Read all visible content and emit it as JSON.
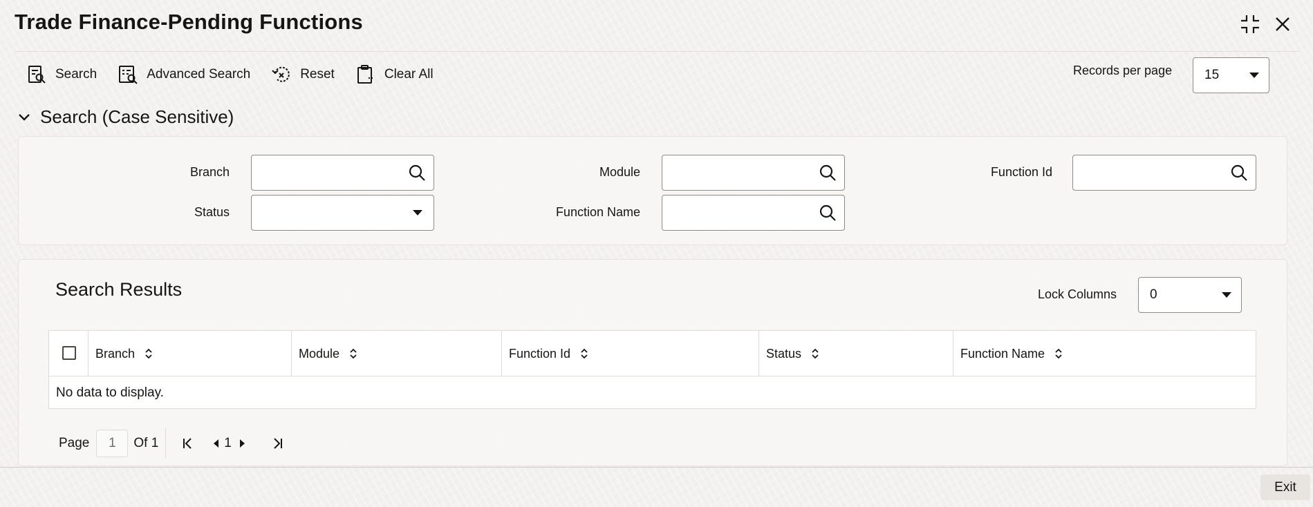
{
  "window": {
    "title": "Trade Finance-Pending Functions",
    "collapse_icon": "collapse-icon",
    "close_icon": "close-icon"
  },
  "toolbar": {
    "search_label": "Search",
    "advanced_search_label": "Advanced Search",
    "reset_label": "Reset",
    "clear_all_label": "Clear All"
  },
  "records_per_page": {
    "label": "Records per page",
    "value": "15"
  },
  "search_section": {
    "title": "Search (Case Sensitive)",
    "fields": {
      "branch": {
        "label": "Branch",
        "value": ""
      },
      "module": {
        "label": "Module",
        "value": ""
      },
      "function_id": {
        "label": "Function Id",
        "value": ""
      },
      "status": {
        "label": "Status",
        "value": ""
      },
      "function_name": {
        "label": "Function Name",
        "value": ""
      }
    }
  },
  "results": {
    "title": "Search Results",
    "lock_columns_label": "Lock Columns",
    "lock_columns_value": "0",
    "columns": [
      "Branch",
      "Module",
      "Function Id",
      "Status",
      "Function Name"
    ],
    "empty_message": "No data to display."
  },
  "pagination": {
    "page_label": "Page",
    "page_value": "1",
    "of_label": "Of 1",
    "current": "1"
  },
  "footer": {
    "exit_label": "Exit"
  },
  "colors": {
    "text": "#161513",
    "border": "#8e8a85",
    "panel": "#f7f6f4"
  }
}
